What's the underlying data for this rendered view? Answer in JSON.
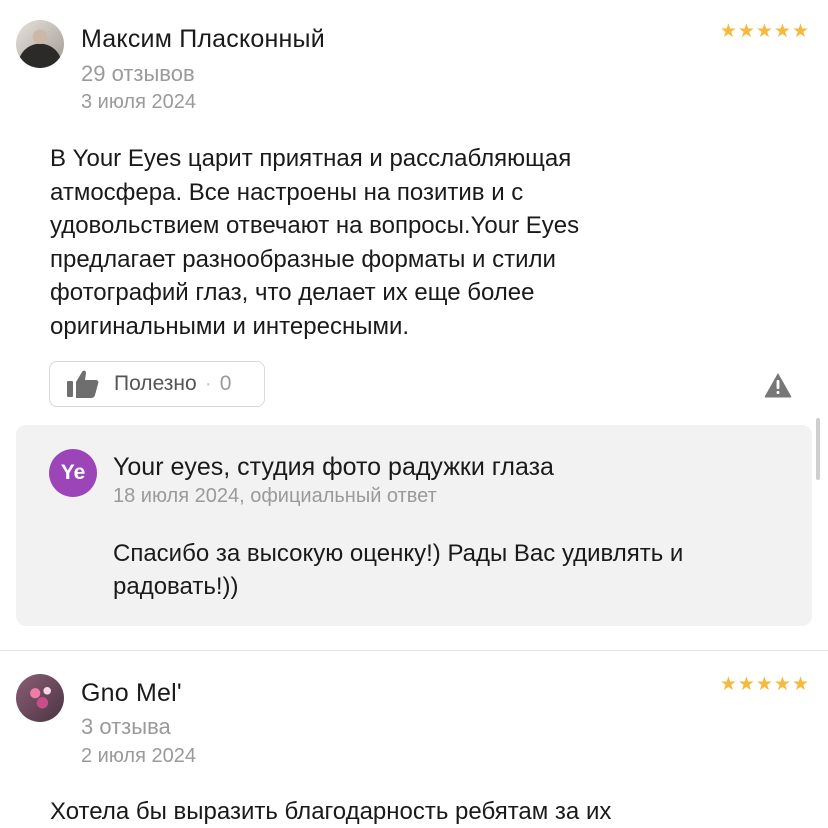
{
  "reviews": [
    {
      "author": "Максим Пласконный",
      "reviews_count": "29 отзывов",
      "date": "3 июля 2024",
      "rating_stars": "★★★★★",
      "text": "В Your Eyes царит приятная и расслабляющая атмосфера. Все настроены на позитив и с удовольствием отвечают на вопросы.Your Eyes предлагает разнообразные форматы и стили фотографий глаз, что делает их еще более оригинальными и интересными.",
      "helpful_label": "Полезно",
      "helpful_count": "0",
      "reply": {
        "org_initials": "Ye",
        "org_name": "Your eyes, студия фото радужки глаза",
        "meta": "18 июля 2024, официальный ответ",
        "text": "Спасибо за высокую оценку!) Рады Вас удивлять и радовать!))"
      }
    },
    {
      "author": "Gno Mel'",
      "reviews_count": "3 отзыва",
      "date": "2 июля 2024",
      "rating_stars": "★★★★★",
      "text": "Хотела бы выразить благодарность ребятам за их"
    }
  ],
  "colors": {
    "star": "#f6b93b",
    "org_avatar": "#9b45b9",
    "reply_bg": "#f2f2f2",
    "muted_text": "#9a9a9a"
  },
  "icons": {
    "helpful": "thumbs-up-icon",
    "report": "warning-icon"
  }
}
